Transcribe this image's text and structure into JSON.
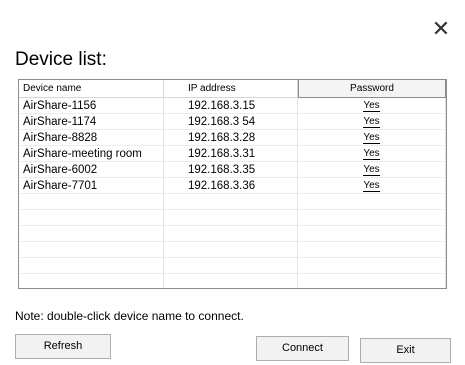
{
  "window": {
    "close_glyph": "✕"
  },
  "title": "Device list:",
  "table": {
    "columns": [
      "Device name",
      "IP address",
      "Password"
    ],
    "rows": [
      {
        "name": "AirShare-1156",
        "ip": "192.168.3.15",
        "password": "Yes"
      },
      {
        "name": "AirShare-1174",
        "ip": "192.168.3 54",
        "password": "Yes"
      },
      {
        "name": "AirShare-8828",
        "ip": "192.168.3.28",
        "password": "Yes"
      },
      {
        "name": "AirShare-meeting room",
        "ip": "192.168.3.31",
        "password": "Yes"
      },
      {
        "name": "AirShare-6002",
        "ip": "192.168.3.35",
        "password": "Yes"
      },
      {
        "name": "AirShare-7701",
        "ip": "192.168.3.36",
        "password": "Yes"
      }
    ],
    "empty_rows": 6
  },
  "note": "Note: double-click device name to connect.",
  "buttons": {
    "refresh": "Refresh",
    "connect": "Connect",
    "exit": "Exit"
  },
  "icons": {
    "close": "close-icon"
  }
}
